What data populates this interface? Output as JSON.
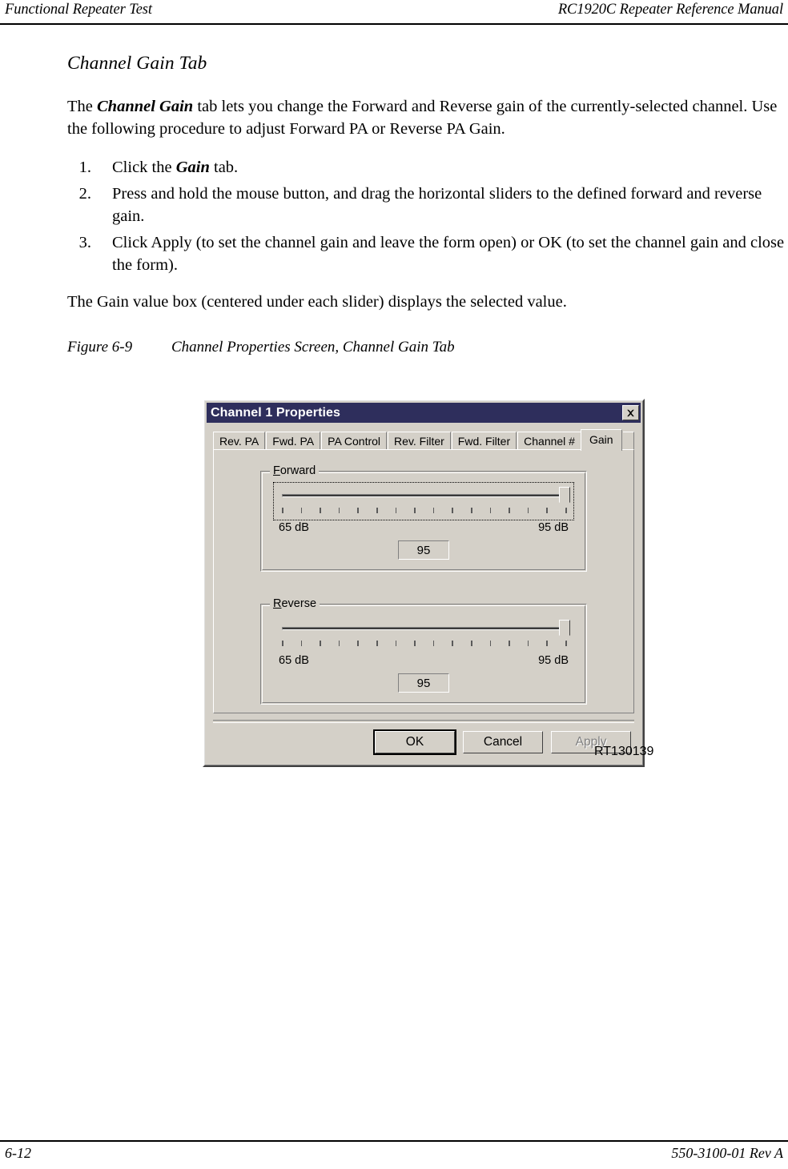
{
  "running_head": {
    "left": "Functional Repeater Test",
    "right": "RC1920C Repeater Reference Manual"
  },
  "section": {
    "heading": "Channel Gain Tab",
    "intro_part1": "The ",
    "intro_emphasis": "Channel Gain",
    "intro_part2": " tab lets you change the Forward and Reverse gain of the currently-selected channel. Use the following procedure to adjust Forward PA or Reverse PA Gain.",
    "steps": [
      {
        "num": "1.",
        "text_part1": "Click the ",
        "emphasis": "Gain",
        "text_part2": " tab."
      },
      {
        "num": "2.",
        "text_part1": "Press and hold the mouse button, and drag the horizontal sliders to the defined forward and reverse gain.",
        "emphasis": "",
        "text_part2": ""
      },
      {
        "num": "3.",
        "text_part1": "Click Apply (to set the channel gain and leave the form open) or OK (to set the channel gain and close the form).",
        "emphasis": "",
        "text_part2": ""
      }
    ],
    "closing": "The Gain value box (centered under each slider) displays the selected value."
  },
  "figure": {
    "number": "Figure 6-9",
    "caption": "Channel Properties Screen, Channel Gain Tab",
    "figure_id": "RT130139"
  },
  "dialog": {
    "title": "Channel 1 Properties",
    "close_icon": "close-icon",
    "titlebar_color": "#2e2e5c",
    "face_color": "#d4d0c8",
    "tabs": [
      {
        "label": "Rev. PA",
        "active": false
      },
      {
        "label": "Fwd. PA",
        "active": false
      },
      {
        "label": "PA Control",
        "active": false
      },
      {
        "label": "Rev. Filter",
        "active": false
      },
      {
        "label": "Fwd. Filter",
        "active": false
      },
      {
        "label": "Channel #",
        "active": false
      },
      {
        "label": "Gain",
        "active": true
      }
    ],
    "groups": [
      {
        "legend_accel": "F",
        "legend_rest": "orward",
        "min_label": "65 dB",
        "max_label": "95 dB",
        "value": "95",
        "focused": true,
        "thumb_percent": 100,
        "ticks": 16
      },
      {
        "legend_accel": "R",
        "legend_rest": "everse",
        "min_label": "65 dB",
        "max_label": "95 dB",
        "value": "95",
        "focused": false,
        "thumb_percent": 100,
        "ticks": 16
      }
    ],
    "buttons": [
      {
        "label": "OK",
        "state": "default"
      },
      {
        "label": "Cancel",
        "state": "normal"
      },
      {
        "label": "Apply",
        "state": "disabled"
      }
    ]
  },
  "footer": {
    "left": "6-12",
    "right": "550-3100-01 Rev A"
  }
}
